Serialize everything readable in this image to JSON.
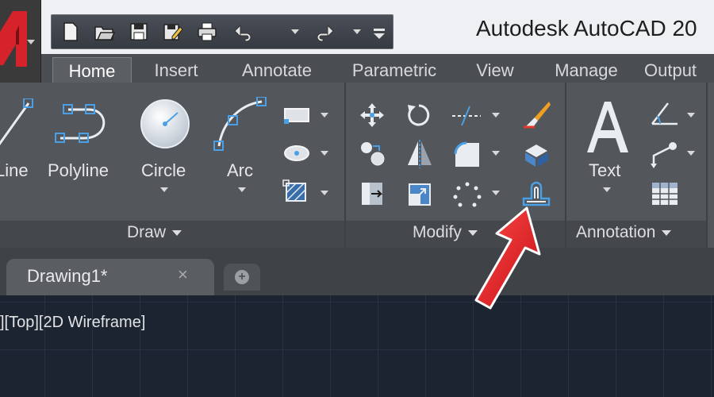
{
  "window": {
    "title": "Autodesk AutoCAD 20"
  },
  "app_button": {
    "icon": "autocad-logo-icon",
    "accent": "#d5222b"
  },
  "quick_access": {
    "items": [
      "new-icon",
      "open-icon",
      "save-icon",
      "save-as-icon",
      "print-icon",
      "undo-icon",
      "redo-icon",
      "customize-icon"
    ]
  },
  "tabs": [
    "Home",
    "Insert",
    "Annotate",
    "Parametric",
    "View",
    "Manage",
    "Output"
  ],
  "active_tab": "Home",
  "draw_panel": {
    "title": "Draw",
    "tools": [
      {
        "label": "Line",
        "icon": "line-icon"
      },
      {
        "label": "Polyline",
        "icon": "polyline-icon"
      },
      {
        "label": "Circle",
        "icon": "circle-icon"
      },
      {
        "label": "Arc",
        "icon": "arc-icon"
      }
    ],
    "small_tools": [
      "rectangle-icon",
      "ellipse-icon",
      "hatch-icon"
    ]
  },
  "modify_panel": {
    "title": "Modify",
    "tools": [
      "move-icon",
      "rotate-icon",
      "trim-icon",
      "erase-icon",
      "copy-icon",
      "mirror-icon",
      "fillet-icon",
      "explode-icon",
      "stretch-icon",
      "scale-icon",
      "array-icon",
      "offset-icon"
    ]
  },
  "annotation_panel": {
    "title": "Annotation",
    "tools": [
      {
        "label": "Text",
        "icon": "text-icon"
      }
    ],
    "small_tools": [
      "dimension-icon",
      "leader-icon",
      "table-icon"
    ]
  },
  "document_tabs": [
    {
      "label": "Drawing1*",
      "close": "×"
    }
  ],
  "new_tab_icon": "plus-icon",
  "viewport_label": "][Top][2D Wireframe]",
  "callout": {
    "icon": "red-arrow-icon",
    "color": "#e8141b"
  }
}
